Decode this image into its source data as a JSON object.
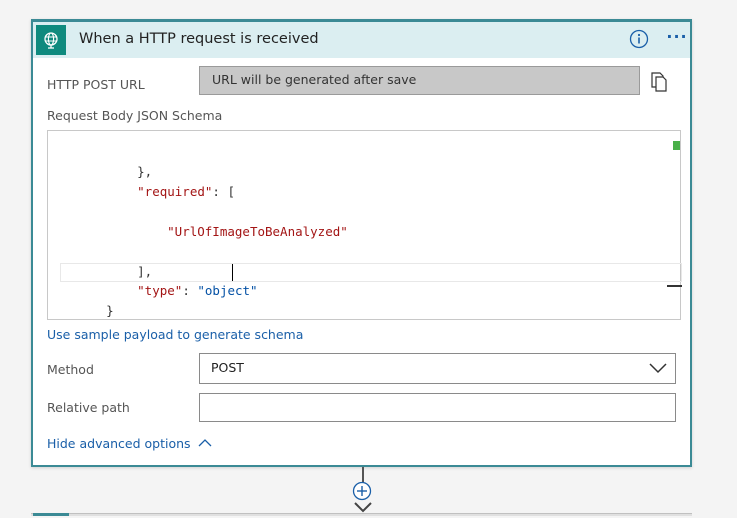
{
  "trigger": {
    "title": "When a HTTP request is received",
    "icon": "globe-icon",
    "accent_color": "#0f8a7e",
    "header_bg": "#dbeef1"
  },
  "url_field": {
    "label": "HTTP POST URL",
    "value": "URL will be generated after save"
  },
  "schema": {
    "label": "Request Body JSON Schema",
    "lines": [
      {
        "text": "},",
        "kind": "punct"
      },
      {
        "key": "\"required\"",
        "rest": ": ["
      },
      {
        "text": "\"UrlOfImageToBeAnalyzed\"",
        "kind": "str"
      },
      {
        "text": "],",
        "kind": "punct"
      },
      {
        "key": "\"type\"",
        "sep": ": ",
        "val": "\"object\""
      },
      {
        "text": "}",
        "kind": "punct"
      }
    ]
  },
  "sample_payload_link": "Use sample payload to generate schema",
  "method": {
    "label": "Method",
    "selected": "POST"
  },
  "relative_path": {
    "label": "Relative path",
    "value": ""
  },
  "advanced_toggle": "Hide advanced options"
}
